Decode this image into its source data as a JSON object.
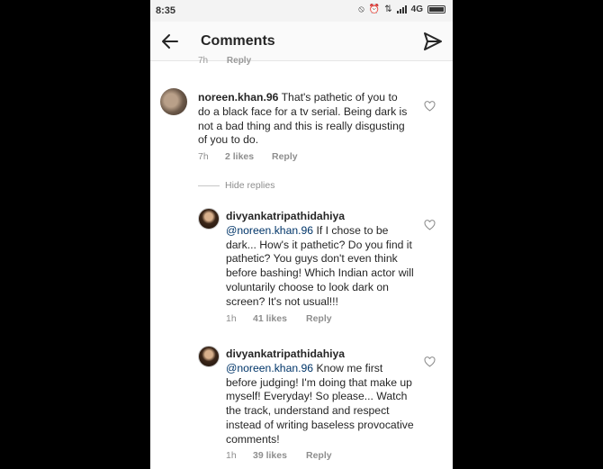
{
  "status_bar": {
    "time": "8:35",
    "network": "4G",
    "icons": [
      "mute-icon",
      "alarm-icon",
      "data-transfer-icon",
      "signal-icon",
      "battery-icon"
    ]
  },
  "header": {
    "title": "Comments",
    "back_icon": "back-arrow-icon",
    "send_icon": "send-icon"
  },
  "previous_comment_meta": {
    "time": "7h",
    "reply": "Reply"
  },
  "comments": [
    {
      "username": "noreen.khan.96",
      "text": "That's pathetic of you to do a black face for a tv serial. Being dark is not a bad thing and this is really disgusting of you to do.",
      "time": "7h",
      "likes": "2 likes",
      "reply": "Reply"
    }
  ],
  "replies_toggle": "Hide replies",
  "replies": [
    {
      "username": "divyankatripathidahiya",
      "mention": "@noreen.khan.96",
      "text": "If I chose to be dark... How's it pathetic? Do you find it pathetic? You guys don't even think before bashing! Which Indian actor will voluntarily choose to look dark on screen? It's not usual!!!",
      "time": "1h",
      "likes": "41 likes",
      "reply": "Reply"
    },
    {
      "username": "divyankatripathidahiya",
      "mention": "@noreen.khan.96",
      "text": "Know me first before judging! I'm doing that make up myself! Everyday! So please... Watch the track, understand and respect instead of writing baseless provocative comments!",
      "time": "1h",
      "likes": "39 likes",
      "reply": "Reply"
    }
  ]
}
